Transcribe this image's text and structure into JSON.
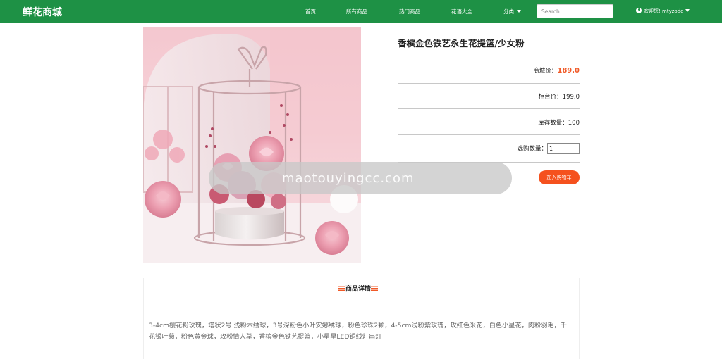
{
  "nav": {
    "brand": "鲜花商城",
    "links": [
      "首页",
      "所有商品",
      "热门商品",
      "花语大全",
      "分类"
    ],
    "search_placeholder": "Search",
    "user_text": "欢迎您! mtyzode"
  },
  "product": {
    "title": "香槟金色铁艺永生花提篮/少女粉",
    "mall_price_label": "商城价：",
    "mall_price": "189.0",
    "counter_price_label": "柜台价：",
    "counter_price": "199.0",
    "stock_label": "库存数量：",
    "stock": "100",
    "quantity_label": "选购数量：",
    "quantity": "1",
    "add_to_cart": "加入购物车"
  },
  "watermark": "maotouyingcc.com",
  "detail": {
    "heading": "商品详情",
    "text": "3-4cm樱花粉玫瑰，塔状2号 浅粉木绣球，3号深粉色小叶安娜绣球，粉色珍珠2颗，4-5cm浅粉紫玫瑰，玫红色米花，白色小星花，肉粉羽毛，千花银叶菊，粉色黄金球，玫粉情人草，香槟金色铁艺提篮，小星星LED铜线灯串灯"
  }
}
